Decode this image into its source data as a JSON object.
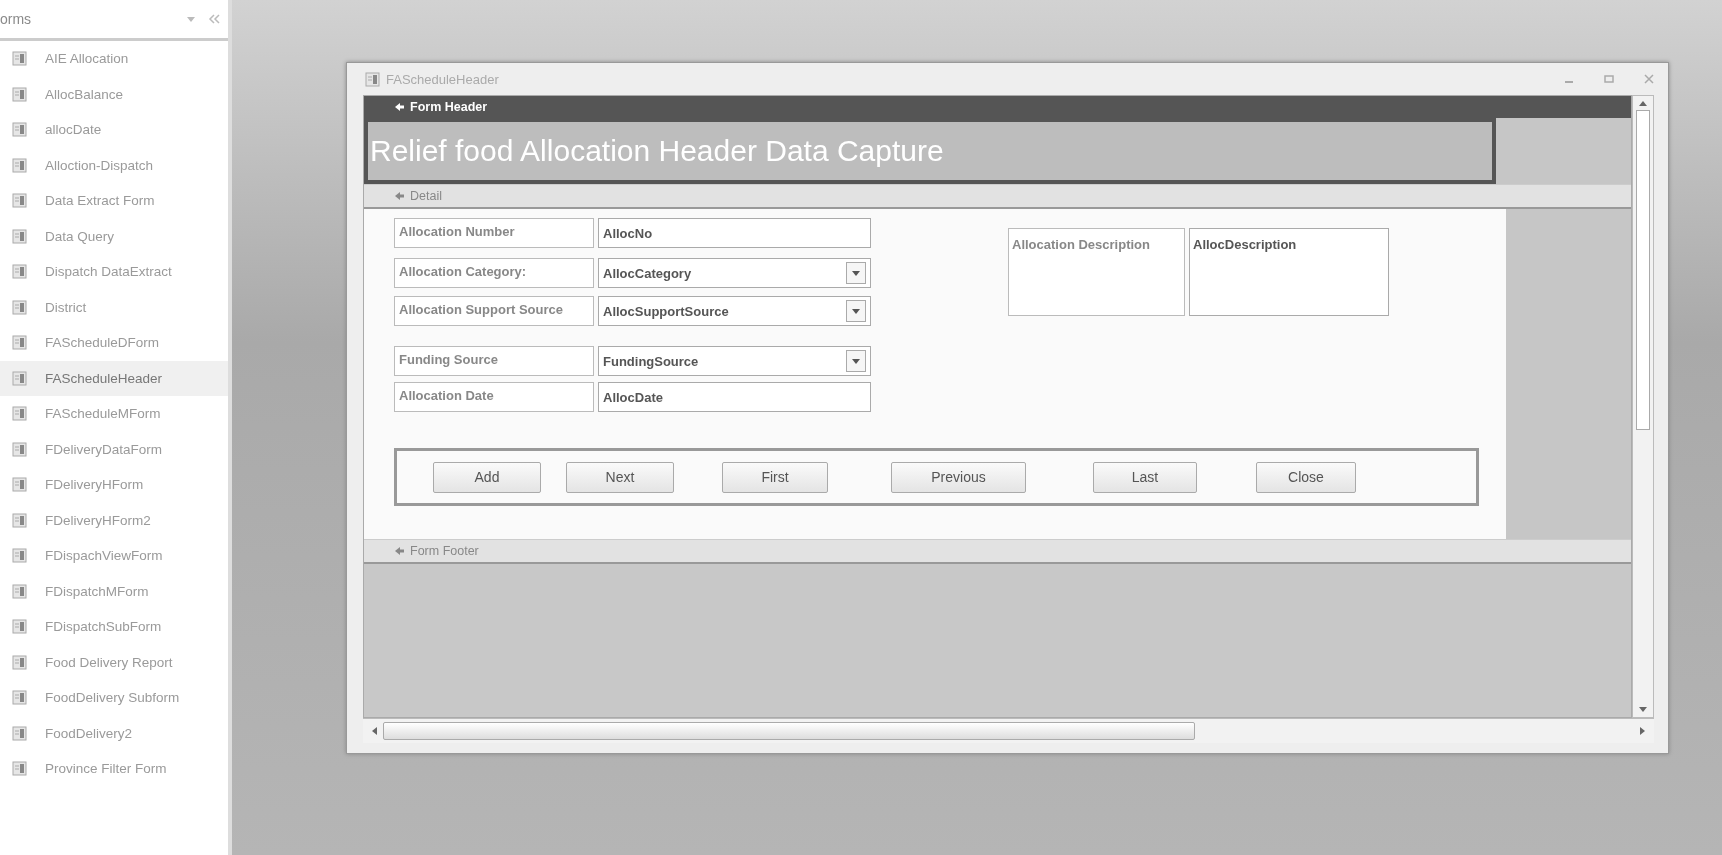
{
  "sidebar": {
    "title": "orms",
    "items": [
      {
        "label": "AIE Allocation",
        "selected": false
      },
      {
        "label": "AllocBalance",
        "selected": false
      },
      {
        "label": "allocDate",
        "selected": false
      },
      {
        "label": "Alloction-Dispatch",
        "selected": false
      },
      {
        "label": "Data Extract Form",
        "selected": false
      },
      {
        "label": "Data Query",
        "selected": false
      },
      {
        "label": "Dispatch DataExtract",
        "selected": false
      },
      {
        "label": "District",
        "selected": false
      },
      {
        "label": "FAScheduleDForm",
        "selected": false
      },
      {
        "label": "FAScheduleHeader",
        "selected": true
      },
      {
        "label": "FAScheduleMForm",
        "selected": false
      },
      {
        "label": "FDeliveryDataForm",
        "selected": false
      },
      {
        "label": "FDeliveryHForm",
        "selected": false
      },
      {
        "label": "FDeliveryHForm2",
        "selected": false
      },
      {
        "label": "FDispachViewForm",
        "selected": false
      },
      {
        "label": "FDispatchMForm",
        "selected": false
      },
      {
        "label": "FDispatchSubForm",
        "selected": false
      },
      {
        "label": "Food Delivery Report",
        "selected": false
      },
      {
        "label": "FoodDelivery Subform",
        "selected": false
      },
      {
        "label": "FoodDelivery2",
        "selected": false
      },
      {
        "label": "Province Filter Form",
        "selected": false
      }
    ]
  },
  "window": {
    "title": "FAScheduleHeader"
  },
  "form_header": {
    "label": "Form Header",
    "heading": "Relief food Allocation Header Data Capture"
  },
  "detail": {
    "label": "Detail",
    "fields": [
      {
        "label": "Allocation Number",
        "value": "AllocNo",
        "kind": "text"
      },
      {
        "label": "Allocation Category:",
        "value": "AllocCategory",
        "kind": "combo"
      },
      {
        "label": "Allocation Support Source",
        "value": "AllocSupportSource",
        "kind": "combo"
      },
      {
        "label": "Funding Source",
        "value": "FundingSource",
        "kind": "combo"
      },
      {
        "label": "Allocation Date",
        "value": "AllocDate",
        "kind": "text"
      }
    ],
    "description": {
      "label": "Allocation Description",
      "value": "AllocDescription"
    },
    "buttons": [
      "Add",
      "Next",
      "First",
      "Previous",
      "Last",
      "Close"
    ]
  },
  "form_footer": {
    "label": "Form Footer"
  }
}
